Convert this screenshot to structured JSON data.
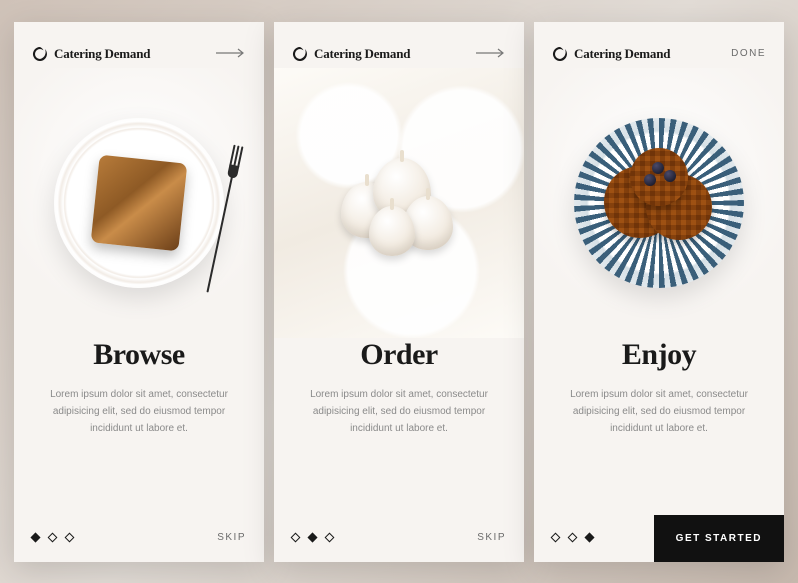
{
  "brand": {
    "name": "Catering Demand"
  },
  "screens": [
    {
      "title": "Browse",
      "body": "Lorem ipsum dolor sit amet, consectetur adipisicing elit, sed do eiusmod tempor incididunt ut labore et.",
      "action_type": "arrow",
      "footer_action": "SKIP",
      "active_dot": 0
    },
    {
      "title": "Order",
      "body": "Lorem ipsum dolor sit amet, consectetur adipisicing elit, sed do eiusmod tempor incididunt ut labore et.",
      "action_type": "arrow",
      "footer_action": "SKIP",
      "active_dot": 1
    },
    {
      "title": "Enjoy",
      "body": "Lorem ipsum dolor sit amet, consectetur adipisicing elit, sed do eiusmod tempor incididunt ut labore et.",
      "action_type": "done",
      "action_label": "DONE",
      "footer_action": "GET STARTED",
      "active_dot": 2
    }
  ],
  "cta": "GET STARTED"
}
